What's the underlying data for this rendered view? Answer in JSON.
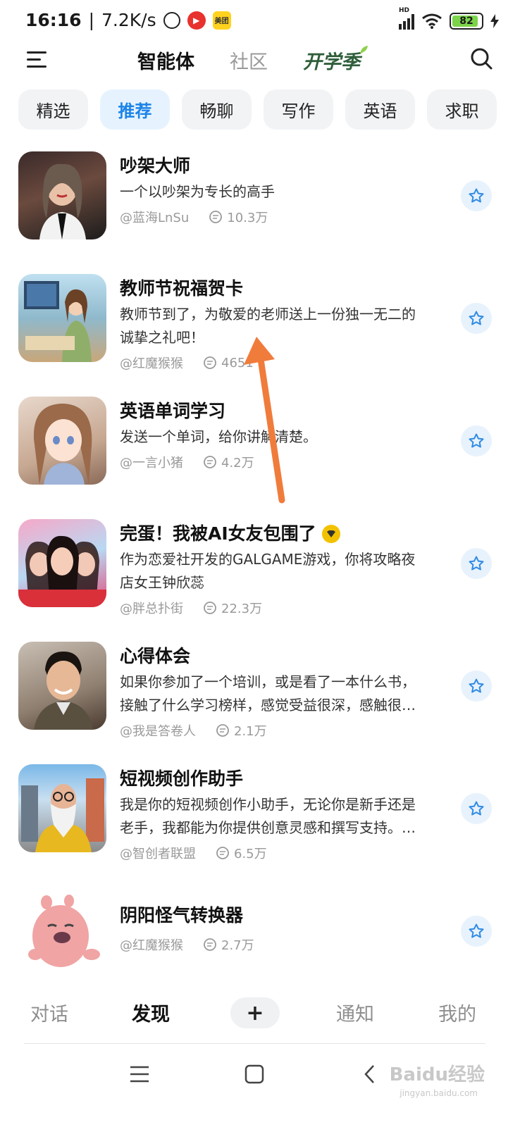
{
  "status_bar": {
    "time": "16:16",
    "speed": "7.2K/s",
    "battery": "82",
    "network": "HD",
    "meituan": "美团"
  },
  "top_nav": {
    "tabs": [
      "智能体",
      "社区",
      "开学季"
    ]
  },
  "chips": [
    "精选",
    "推荐",
    "畅聊",
    "写作",
    "英语",
    "求职"
  ],
  "items": [
    {
      "title": "吵架大师",
      "desc_lines": [
        "一个以吵架为专长的高手"
      ],
      "author": "@蓝海LnSu",
      "count": "10.3万"
    },
    {
      "title": "教师节祝福贺卡",
      "desc_lines": [
        "教师节到了，为敬爱的老师送上一份独一无二的",
        "诚挚之礼吧！"
      ],
      "author": "@红魔猴猴",
      "count": "4651"
    },
    {
      "title": "英语单词学习",
      "desc_lines": [
        "发送一个单词，给你讲解清楚。"
      ],
      "author": "@一言小猪",
      "count": "4.2万"
    },
    {
      "title": "完蛋！我被AI女友包围了",
      "desc_lines": [
        "作为恋爱社开发的GALGAME游戏，你将攻略夜",
        "店女王钟欣蕊"
      ],
      "author": "@胖总扑街",
      "count": "22.3万"
    },
    {
      "title": "心得体会",
      "desc_lines": [
        "如果你参加了一个培训，或是看了一本什么书，",
        "接触了什么学习榜样，感觉受益很深，感触很…"
      ],
      "author": "@我是答卷人",
      "count": "2.1万"
    },
    {
      "title": "短视频创作助手",
      "desc_lines": [
        "我是你的短视频创作小助手，无论你是新手还是",
        "老手，我都能为你提供创意灵感和撰写支持。…"
      ],
      "author": "@智创者联盟",
      "count": "6.5万"
    },
    {
      "title": "阴阳怪气转换器",
      "desc_lines": [],
      "author": "@红魔猴猴",
      "count": "2.7万"
    }
  ],
  "tab_bar": {
    "chat": "对话",
    "discover": "发现",
    "plus": "+",
    "notify": "通知",
    "mine": "我的"
  },
  "watermark": {
    "main": "Baidu经验",
    "sub": "jingyan.baidu.com"
  },
  "colors": {
    "accent": "#1c83e8",
    "annotation_arrow": "#f07c3c"
  }
}
